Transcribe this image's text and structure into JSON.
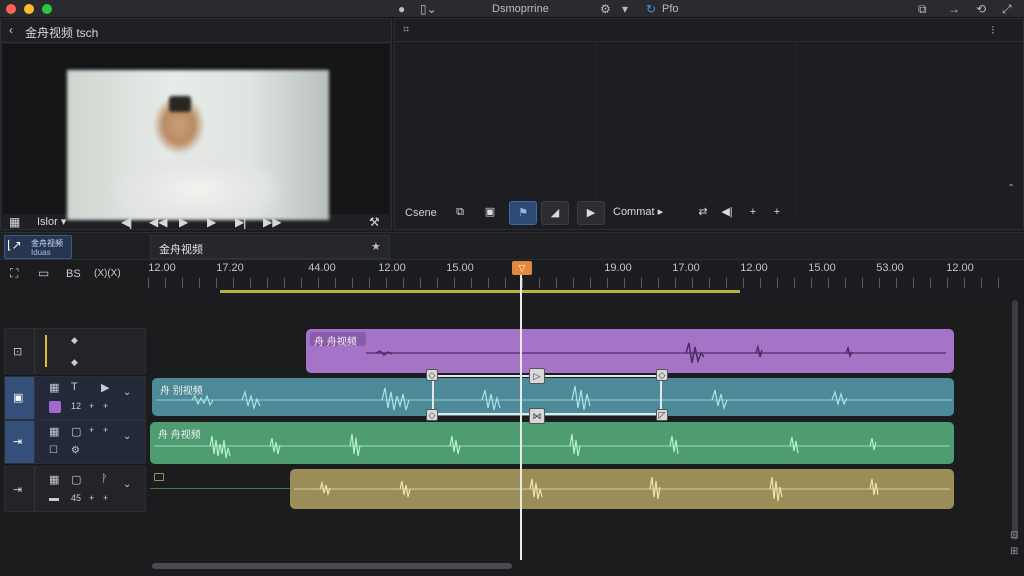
{
  "titlebar": {
    "app_name": "Dsmoprrine",
    "right_menu": "Pfo",
    "colors": {
      "close": "#ff5f57",
      "minimize": "#febc2e",
      "maximize": "#28c840"
    }
  },
  "viewer": {
    "title": "金舟视频 tsch",
    "back_icon": "chevron-left-icon",
    "zoom_label": "Islor",
    "controls": [
      "skip-back-icon",
      "rewind-icon",
      "play-icon",
      "step-forward-icon",
      "next-frame-icon",
      "fast-forward-icon"
    ]
  },
  "panel": {
    "header_left": "⌗",
    "header_right": "⁝",
    "tools": {
      "label_left": "Csene",
      "dropdown_label": "Commat",
      "dropdown_caret": "▸"
    }
  },
  "timeline": {
    "tab_title": "金舟视频",
    "project_label_line1": "金舟视频",
    "project_label_line2": "Iduas",
    "header_tools": [
      "BS",
      "(X)(X)"
    ],
    "ruler_labels": [
      "12.00",
      "17.20",
      "44.00",
      "12.00",
      "15.00",
      "19.00",
      "17.00",
      "12.00",
      "15.00",
      "53.00",
      "12.00"
    ],
    "playhead_marker": "▽",
    "tracks": [
      {
        "name": "track-1",
        "clip_label": "舟 舟视频",
        "clip_color": "#a574c7"
      },
      {
        "name": "track-2",
        "clip_label": "舟 别视频",
        "clip_color": "#4b8a96",
        "row_values": [
          "12",
          "+",
          "+"
        ]
      },
      {
        "name": "track-3",
        "clip_label": "舟 舟视频",
        "clip_color": "#4f9b72",
        "row_values": [
          "+",
          "+"
        ]
      },
      {
        "name": "track-4",
        "clip_label": "",
        "clip_color": "#9a8d58",
        "row_values": [
          "45",
          "+",
          "+"
        ]
      }
    ]
  }
}
